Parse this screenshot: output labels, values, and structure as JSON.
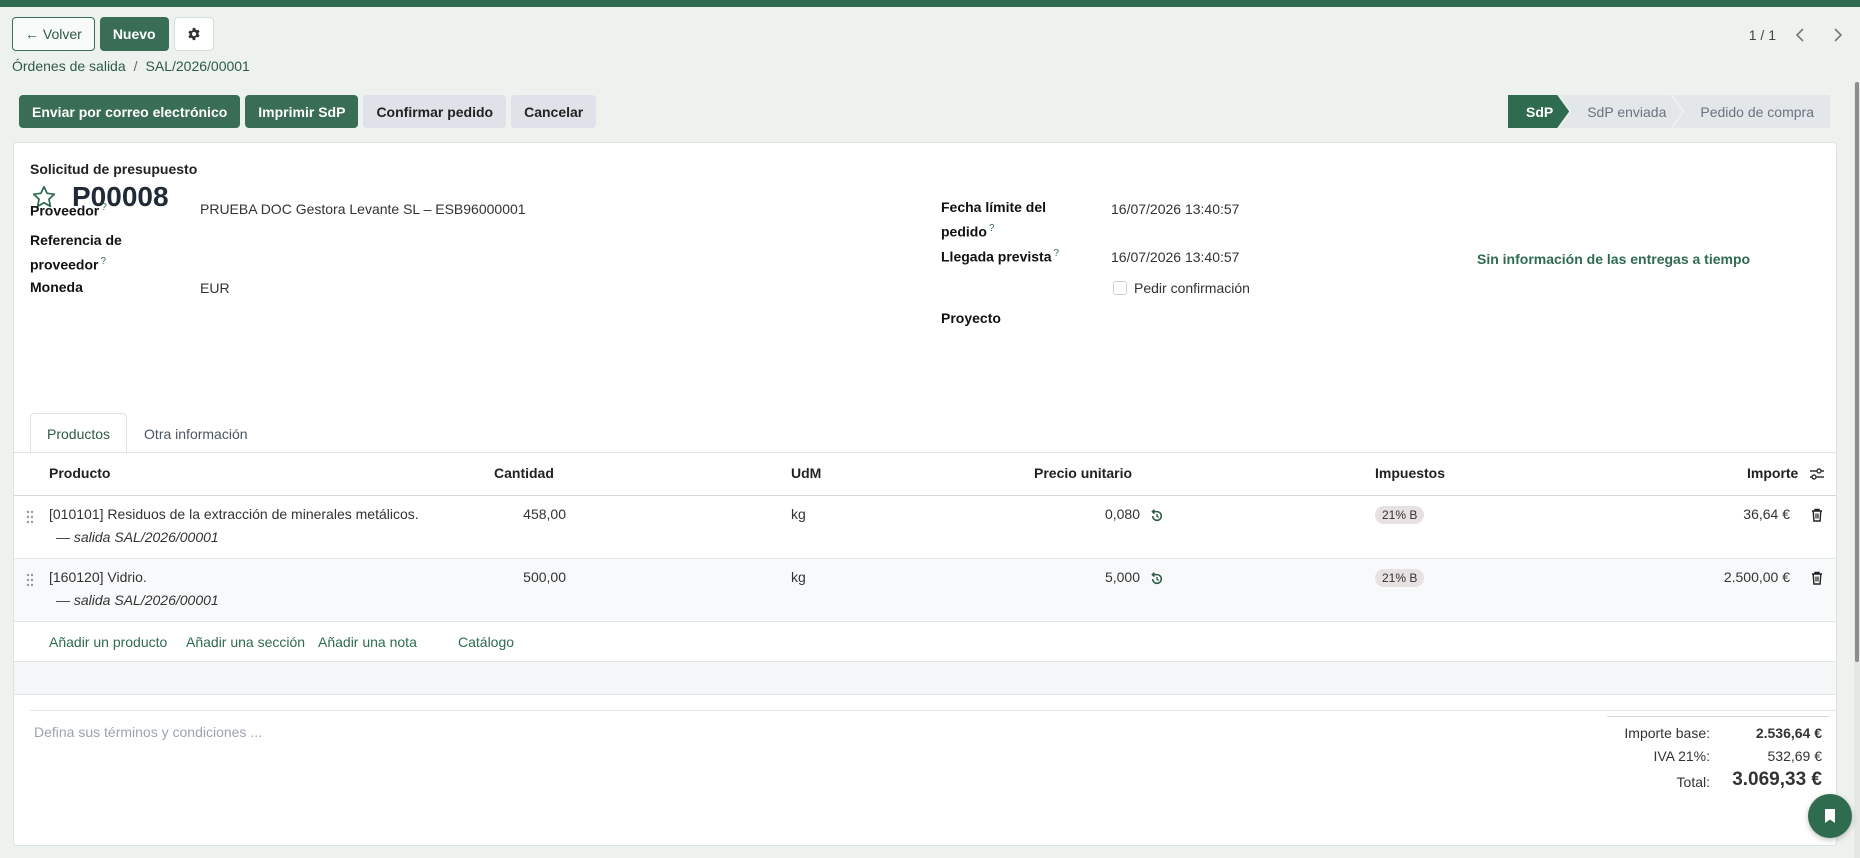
{
  "control": {
    "back_label": "← Volver",
    "new_label": "Nuevo",
    "settings_icon": "gear-icon",
    "pager_text": "1 / 1"
  },
  "breadcrumb": {
    "parent": "Órdenes de salida",
    "separator": "/",
    "current": "SAL/2026/00001"
  },
  "actions": {
    "send_email": "Enviar por correo electrónico",
    "print": "Imprimir SdP",
    "confirm": "Confirmar pedido",
    "cancel": "Cancelar"
  },
  "status": {
    "stages": [
      "SdP",
      "SdP enviada",
      "Pedido de compra"
    ],
    "active": "SdP"
  },
  "form": {
    "doc_kind": "Solicitud de presupuesto",
    "name": "P00008",
    "vendor_label": "Proveedor",
    "vendor_value": "PRUEBA DOC Gestora Levante SL – ESB96000001",
    "ref_label_1": "Referencia de",
    "ref_label_2": "proveedor",
    "currency_label": "Moneda",
    "currency_value": "EUR",
    "deadline_label_1": "Fecha límite del",
    "deadline_label_2": "pedido",
    "deadline_value": "16/07/2026 13:40:57",
    "arrival_label": "Llegada prevista",
    "arrival_value": "16/07/2026 13:40:57",
    "ontime_text": "Sin información de las entregas a tiempo",
    "confirm_request_label": "Pedir confirmación",
    "project_label": "Proyecto",
    "help_mark": "?"
  },
  "tabs": [
    "Productos",
    "Otra información"
  ],
  "table": {
    "headers": {
      "product": "Producto",
      "qty": "Cantidad",
      "uom": "UdM",
      "price": "Precio unitario",
      "taxes": "Impuestos",
      "amount": "Importe"
    },
    "rows": [
      {
        "product": "[010101] Residuos de la extracción de minerales metálicos.",
        "origin": "— salida SAL/2026/00001",
        "qty": "458,00",
        "uom": "kg",
        "price": "0,080",
        "tax": "21% B",
        "amount": "36,64 €"
      },
      {
        "product": "[160120] Vidrio.",
        "origin": "— salida SAL/2026/00001",
        "qty": "500,00",
        "uom": "kg",
        "price": "5,000",
        "tax": "21% B",
        "amount": "2.500,00 €"
      }
    ],
    "add_links": [
      "Añadir un producto",
      "Añadir una sección",
      "Añadir una nota",
      "Catálogo"
    ]
  },
  "footer": {
    "terms_placeholder": "Defina sus términos y condiciones ...",
    "base_label": "Importe base:",
    "base_value": "2.536,64 €",
    "vat_label": "IVA 21%:",
    "vat_value": "532,69 €",
    "total_label": "Total:",
    "total_value": "3.069,33 €"
  },
  "colors": {
    "brand": "#2f6b4f",
    "primary_button": "#3a6d55"
  }
}
